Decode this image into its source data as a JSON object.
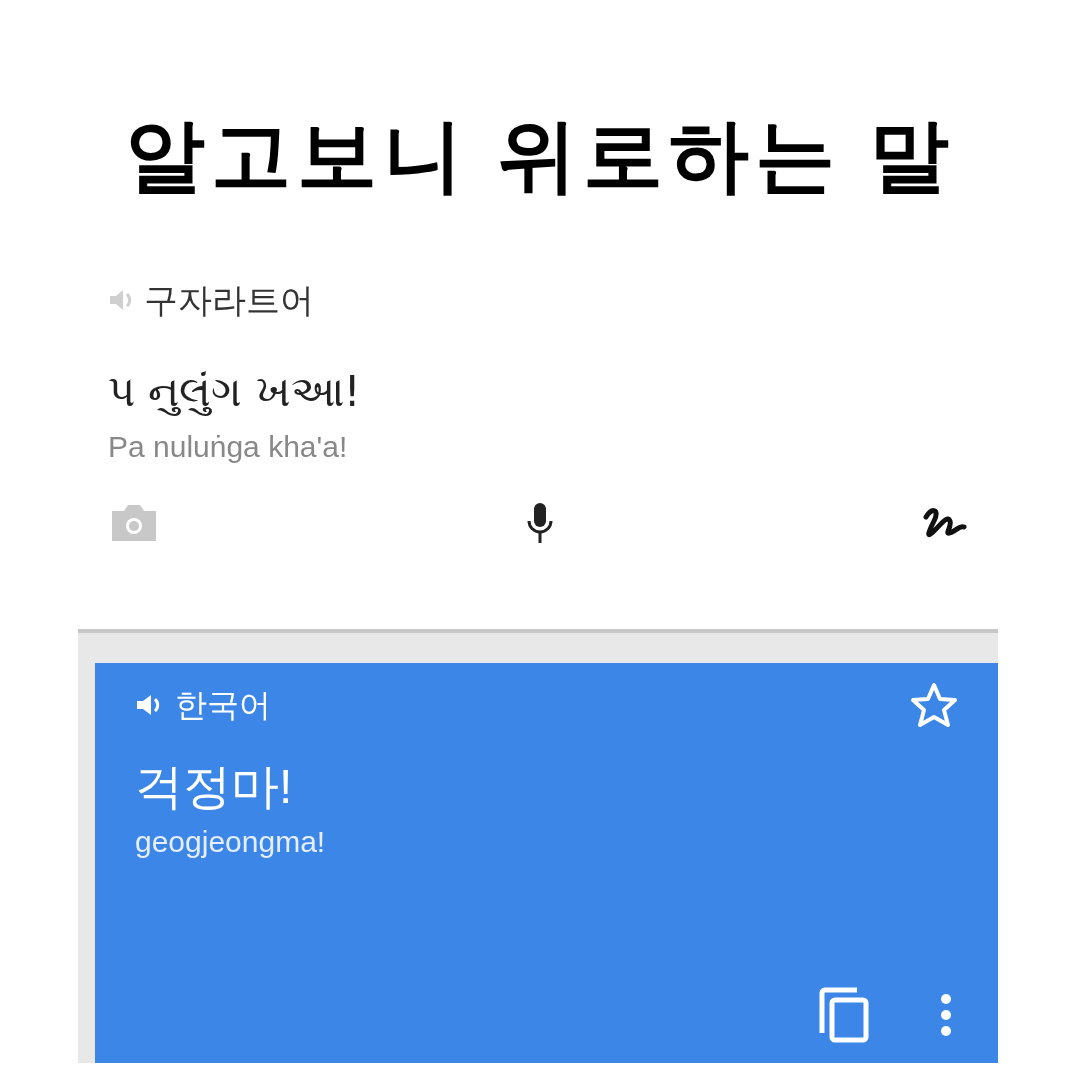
{
  "headline": "알고보니 위로하는 말",
  "source": {
    "language": "구자라트어",
    "text": "પ નુલુંગ ખઆ!",
    "transliteration": "Pa nuluṅga kha'a!"
  },
  "result": {
    "language": "한국어",
    "text": "걱정마!",
    "transliteration": "geogjeongma!"
  }
}
